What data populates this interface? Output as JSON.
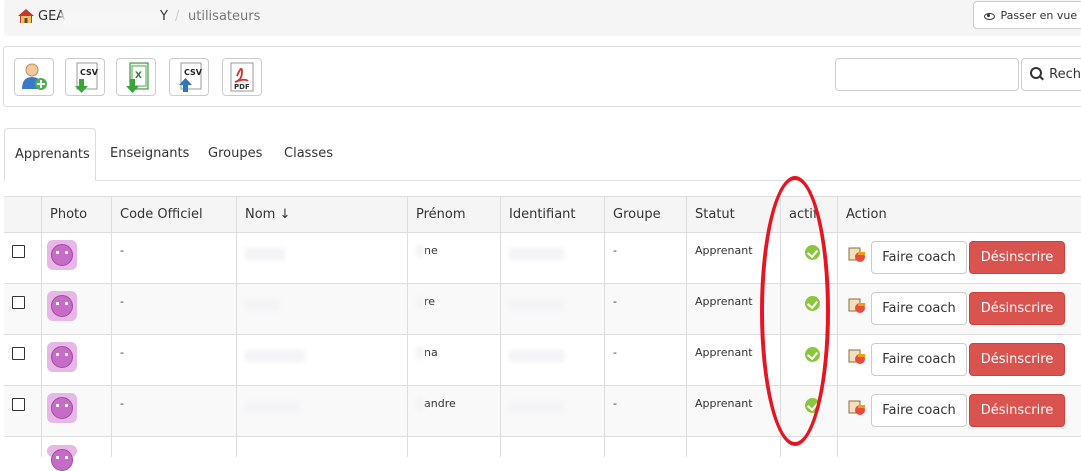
{
  "breadcrumb": {
    "root_start": "GEA",
    "root_end": "Y",
    "separator": "/",
    "current": "utilisateurs",
    "preview_label": "Passer en vue ap"
  },
  "toolbar": {
    "buttons": [
      "add-user",
      "export-csv",
      "export-excel",
      "import-csv",
      "export-pdf"
    ],
    "search_value": "",
    "search_label": "Reche"
  },
  "tabs": [
    "Apprenants",
    "Enseignants",
    "Groupes",
    "Classes"
  ],
  "table": {
    "columns": [
      "",
      "Photo",
      "Code Officiel",
      "Nom ↓",
      "Prénom",
      "Identifiant",
      "Groupe",
      "Statut",
      "actif",
      "Action"
    ],
    "rows": [
      {
        "code": "-",
        "prenom_suffix": "ne",
        "groupe": "-",
        "statut": "Apprenant",
        "actif": true
      },
      {
        "code": "-",
        "prenom_suffix": "re",
        "groupe": "-",
        "statut": "Apprenant",
        "actif": true
      },
      {
        "code": "-",
        "prenom_suffix": "na",
        "groupe": "-",
        "statut": "Apprenant",
        "actif": true
      },
      {
        "code": "-",
        "prenom_suffix": "andre",
        "groupe": "-",
        "statut": "Apprenant",
        "actif": true
      }
    ],
    "coach_label": "Faire coach",
    "unsubscribe_label": "Désinscrire"
  },
  "colors": {
    "danger": "#d9534f",
    "active": "#8cc63f",
    "annotation": "#e51522"
  }
}
